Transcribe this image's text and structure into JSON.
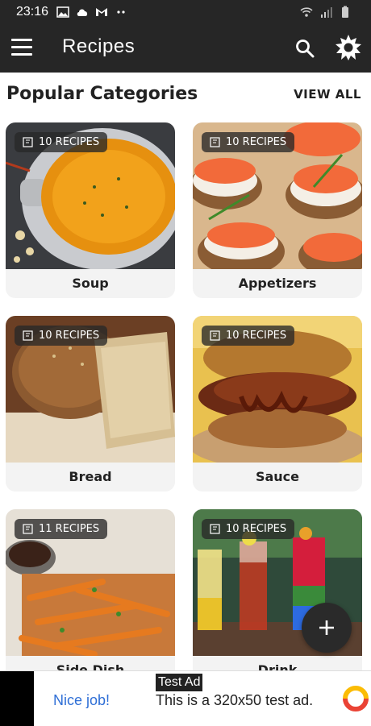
{
  "status_bar": {
    "time": "23:16",
    "left_icons": [
      "image-icon",
      "cloud-icon",
      "gmail-icon",
      "more-dots-icon"
    ],
    "right_icons": [
      "wifi-icon",
      "signal-icon",
      "battery-icon"
    ]
  },
  "app_bar": {
    "title": "Recipes",
    "menu_icon": "hamburger-menu-icon",
    "search_icon": "search-icon",
    "theme_icon": "brightness-icon"
  },
  "section": {
    "title": "Popular Categories",
    "view_all": "VIEW ALL"
  },
  "categories": [
    {
      "name": "Soup",
      "count": "10 RECIPES",
      "accent": "#e8891c"
    },
    {
      "name": "Appetizers",
      "count": "10 RECIPES",
      "accent": "#f0623d"
    },
    {
      "name": "Bread",
      "count": "10 RECIPES",
      "accent": "#b07a45"
    },
    {
      "name": "Sauce",
      "count": "10 RECIPES",
      "accent": "#8c3a1f"
    },
    {
      "name": "Side Dish",
      "count": "11 RECIPES",
      "accent": "#e0782a"
    },
    {
      "name": "Drink",
      "count": "10 RECIPES",
      "accent": "#d8283c"
    }
  ],
  "fab": {
    "icon": "plus-icon"
  },
  "ad": {
    "tag": "Test Ad",
    "headline": "Nice job!",
    "text": "This is a 320x50 test ad."
  },
  "colors": {
    "toolbar": "#262626",
    "card_bg": "#f3f3f3",
    "ad_link": "#2f6fd6"
  }
}
